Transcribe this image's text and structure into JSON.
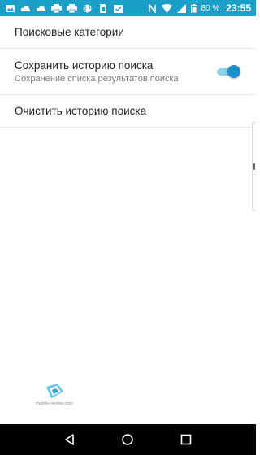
{
  "status_bar": {
    "icons_left": [
      "image-icon",
      "cloud-icon",
      "cloud-icon",
      "printer-icon",
      "printer-icon",
      "globe-icon",
      "sim-card-icon",
      "calendar-check-icon"
    ],
    "icons_right": [
      "nfc-icon",
      "wifi-icon",
      "signal-icon",
      "battery-icon"
    ],
    "battery": "80 %",
    "time": "23:55",
    "color": "#1aa0c8"
  },
  "settings": {
    "categories": {
      "title": "Поисковые категории"
    },
    "save_history": {
      "title": "Сохранить историю поиска",
      "subtitle": "Сохранение списка результатов поиска",
      "enabled": true
    },
    "clear_history": {
      "title": "Очистить историю поиска"
    }
  },
  "watermark": {
    "text": "mobile-review.com"
  },
  "nav_bar": {
    "buttons": [
      "back-icon",
      "home-icon",
      "recents-icon"
    ]
  },
  "colors": {
    "accent": "#1a8fc8",
    "accent_light": "#8fd0e6"
  }
}
